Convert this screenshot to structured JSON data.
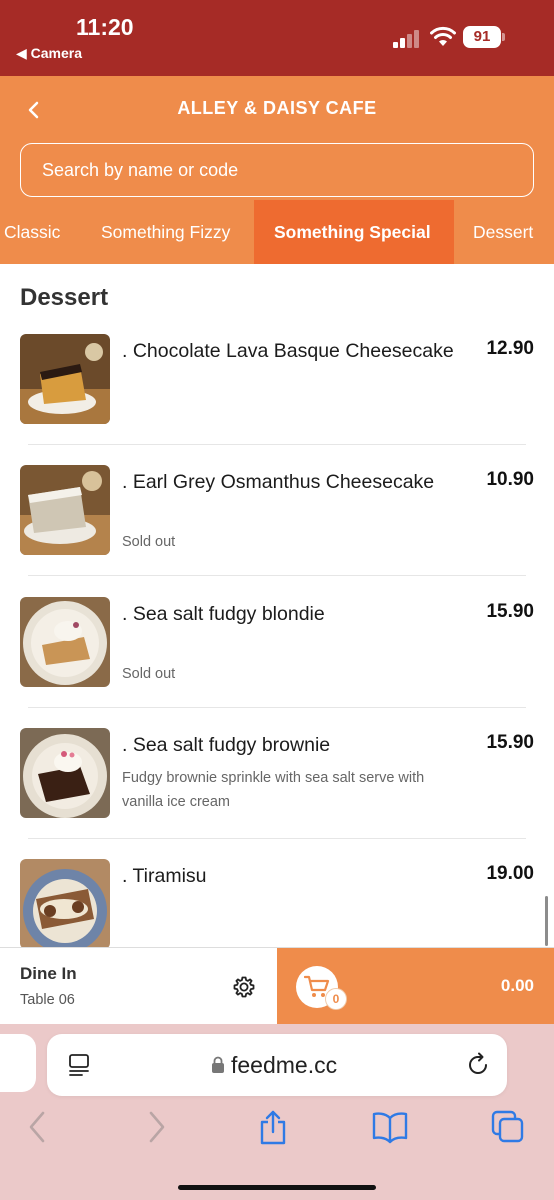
{
  "status_bar": {
    "time": "11:20",
    "back_app": "◀ Camera",
    "battery": "91"
  },
  "header": {
    "title": "ALLEY & DAISY CAFE",
    "search_placeholder": "Search by name or code",
    "tabs": [
      {
        "label": "Classic",
        "active": false
      },
      {
        "label": "Something Fizzy",
        "active": false
      },
      {
        "label": "Something Special",
        "active": true
      },
      {
        "label": "Dessert",
        "active": false
      }
    ]
  },
  "menu": {
    "section_title": "Dessert",
    "items": [
      {
        "name": ". Chocolate Lava Basque Cheesecake",
        "price": "12.90",
        "note": "",
        "description": ""
      },
      {
        "name": ". Earl Grey Osmanthus Cheesecake",
        "price": "10.90",
        "note": "Sold out",
        "description": ""
      },
      {
        "name": ". Sea salt fudgy blondie",
        "price": "15.90",
        "note": "Sold out",
        "description": ""
      },
      {
        "name": ". Sea salt fudgy brownie",
        "price": "15.90",
        "note": "",
        "description": "Fudgy brownie sprinkle with sea salt serve with vanilla ice cream"
      },
      {
        "name": ". Tiramisu",
        "price": "19.00",
        "note": "",
        "description": ""
      }
    ]
  },
  "order_bar": {
    "mode": "Dine In",
    "table": "Table 06",
    "cart_count": "0",
    "total": "0.00"
  },
  "browser": {
    "url": "feedme.cc"
  },
  "colors": {
    "status_bar": "#a62b26",
    "brand_orange": "#ef8c4b",
    "active_tab": "#ee6b30",
    "safari_bg": "#ebc9c9",
    "ios_blue": "#2f7ae5"
  }
}
